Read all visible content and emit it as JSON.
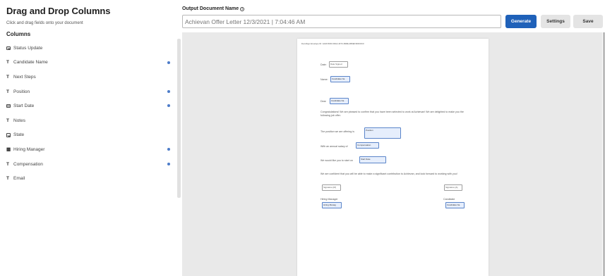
{
  "left": {
    "title": "Drag and Drop Columns",
    "subtitle": "Click and drag fields onto your document",
    "columns_heading": "Columns",
    "columns": [
      {
        "label": "Status Update",
        "icon": "status-icon",
        "used": false
      },
      {
        "label": "Candidate Name",
        "icon": "text-icon",
        "used": true
      },
      {
        "label": "Next Steps",
        "icon": "text-icon",
        "used": false
      },
      {
        "label": "Position",
        "icon": "text-icon",
        "used": true
      },
      {
        "label": "Start Date",
        "icon": "calendar-icon",
        "used": true
      },
      {
        "label": "Notes",
        "icon": "text-icon",
        "used": false
      },
      {
        "label": "State",
        "icon": "status-icon",
        "used": false
      },
      {
        "label": "Hiring Manager",
        "icon": "people-icon",
        "used": true
      },
      {
        "label": "Compensation",
        "icon": "text-icon",
        "used": true
      },
      {
        "label": "Email",
        "icon": "text-icon",
        "used": false
      }
    ]
  },
  "header": {
    "output_label": "Output Document Name",
    "output_value": "Achievan Offer Letter 12/3/2021 | 7:04:46 AM",
    "generate": "Generate",
    "settings": "Settings",
    "save": "Save"
  },
  "document": {
    "envelope_id": "DocuSign Envelope ID: 1A0A7D3F-6D4A-4F7C-B48E-4B0EF3D0C0C0",
    "date_label": "Date:",
    "date_field": "Date Signed",
    "name_label": "Name:",
    "name_field": "Candidate Na",
    "dear_label": "Dear",
    "dear_field": "Candidate Na",
    "congrats": "Congratulations! We are pleased to confirm that you have been selected to work at Achievan! We are delighted to make you the following job offer.",
    "position_text": "The position we are offering is",
    "position_field": "Position",
    "salary_text": "With an annual salary of",
    "salary_field": "Compensation",
    "start_text": "We would like you to start on",
    "start_field": "Start Date",
    "confident_text": "We are confident that you will be able to make a significant contribution to Achievan, and look forward to working with you!",
    "sig_left": "Signature [M]",
    "sig_right": "Signature [A]",
    "hm_label": "Hiring Manager",
    "hm_field": "Hiring Manag",
    "cand_label": "Candidate",
    "cand_field": "Candidate Na"
  }
}
